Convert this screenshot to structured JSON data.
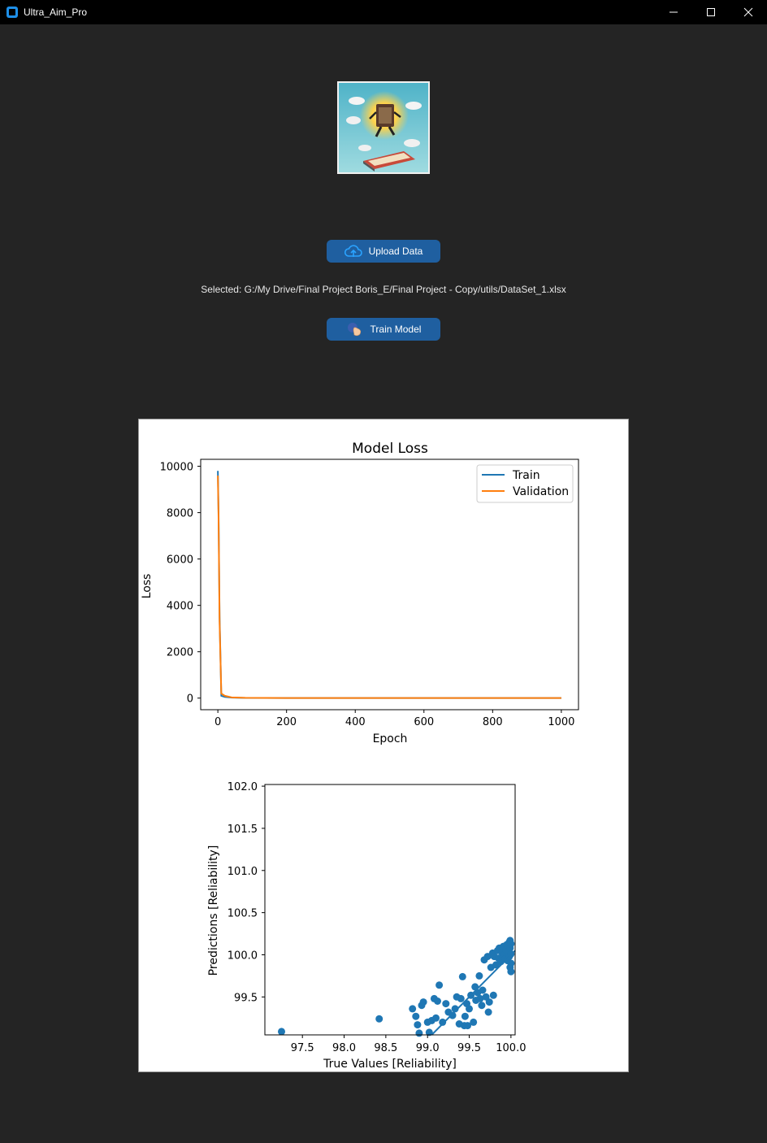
{
  "window": {
    "title": "Ultra_Aim_Pro"
  },
  "actions": {
    "upload_label": "Upload Data",
    "train_label": "Train Model",
    "selected_text": "Selected: G:/My Drive/Final Project Boris_E/Final Project - Copy/utils/DataSet_1.xlsx"
  },
  "colors": {
    "accent": "#1f5fa0",
    "train": "#1f77b4",
    "validation": "#ff7f0e"
  },
  "chart_data": [
    {
      "type": "line",
      "title": "Model Loss",
      "xlabel": "Epoch",
      "ylabel": "Loss",
      "xlim": [
        -50,
        1050
      ],
      "ylim": [
        -500,
        10300
      ],
      "xticks": [
        0,
        200,
        400,
        600,
        800,
        1000
      ],
      "yticks": [
        0,
        2000,
        4000,
        6000,
        8000,
        10000
      ],
      "legend": "top-right",
      "series": [
        {
          "name": "Train",
          "color": "#1f77b4",
          "x": [
            0,
            2,
            5,
            10,
            20,
            40,
            80,
            200,
            400,
            600,
            800,
            1000
          ],
          "y": [
            9800,
            8000,
            3500,
            100,
            50,
            20,
            10,
            5,
            4,
            3,
            3,
            3
          ]
        },
        {
          "name": "Validation",
          "color": "#ff7f0e",
          "x": [
            0,
            2,
            5,
            10,
            20,
            40,
            80,
            200,
            400,
            600,
            800,
            1000
          ],
          "y": [
            9600,
            7800,
            3300,
            200,
            100,
            30,
            12,
            6,
            5,
            4,
            4,
            4
          ]
        }
      ]
    },
    {
      "type": "scatter",
      "xlabel": "True Values [Reliability]",
      "ylabel": "Predictions [Reliability]",
      "xlim": [
        97.05,
        100.05
      ],
      "ylim": [
        99.05,
        102.02
      ],
      "xticks": [
        97.5,
        98.0,
        98.5,
        99.0,
        99.5,
        100.0
      ],
      "yticks": [
        99.5,
        100.0,
        100.5,
        101.0,
        101.5,
        102.0
      ],
      "color": "#1f77b4",
      "reference_line": [
        [
          99.05,
          99.05
        ],
        [
          100.05,
          100.05
        ]
      ],
      "points": [
        [
          97.25,
          99.09
        ],
        [
          98.42,
          99.24
        ],
        [
          98.82,
          99.36
        ],
        [
          98.86,
          99.27
        ],
        [
          98.88,
          99.17
        ],
        [
          98.9,
          99.07
        ],
        [
          98.93,
          99.4
        ],
        [
          98.95,
          99.44
        ],
        [
          99.0,
          99.2
        ],
        [
          99.02,
          99.08
        ],
        [
          99.05,
          99.22
        ],
        [
          99.08,
          99.48
        ],
        [
          99.1,
          99.25
        ],
        [
          99.12,
          99.45
        ],
        [
          99.14,
          99.64
        ],
        [
          99.18,
          99.2
        ],
        [
          99.22,
          99.42
        ],
        [
          99.25,
          99.32
        ],
        [
          99.3,
          99.28
        ],
        [
          99.33,
          99.36
        ],
        [
          99.35,
          99.5
        ],
        [
          99.38,
          99.18
        ],
        [
          99.4,
          99.48
        ],
        [
          99.42,
          99.74
        ],
        [
          99.44,
          99.16
        ],
        [
          99.45,
          99.27
        ],
        [
          99.47,
          99.42
        ],
        [
          99.48,
          99.16
        ],
        [
          99.5,
          99.36
        ],
        [
          99.52,
          99.52
        ],
        [
          99.55,
          99.2
        ],
        [
          99.57,
          99.62
        ],
        [
          99.58,
          99.46
        ],
        [
          99.6,
          99.55
        ],
        [
          99.62,
          99.75
        ],
        [
          99.63,
          99.48
        ],
        [
          99.65,
          99.4
        ],
        [
          99.66,
          99.58
        ],
        [
          99.68,
          99.94
        ],
        [
          99.7,
          99.5
        ],
        [
          99.72,
          99.98
        ],
        [
          99.73,
          99.32
        ],
        [
          99.74,
          99.44
        ],
        [
          99.76,
          99.85
        ],
        [
          99.78,
          100.02
        ],
        [
          99.79,
          99.52
        ],
        [
          99.8,
          99.98
        ],
        [
          99.82,
          99.88
        ],
        [
          99.84,
          100.05
        ],
        [
          99.85,
          99.96
        ],
        [
          99.86,
          100.08
        ],
        [
          99.88,
          99.92
        ],
        [
          99.89,
          100.03
        ],
        [
          99.9,
          99.96
        ],
        [
          99.91,
          100.1
        ],
        [
          99.92,
          100.0
        ],
        [
          99.93,
          99.95
        ],
        [
          99.94,
          100.06
        ],
        [
          99.95,
          100.12
        ],
        [
          99.96,
          99.93
        ],
        [
          99.97,
          100.04
        ],
        [
          99.98,
          100.15
        ],
        [
          99.98,
          99.98
        ],
        [
          99.99,
          100.08
        ],
        [
          99.99,
          99.85
        ],
        [
          100.0,
          100.13
        ],
        [
          100.0,
          99.9
        ],
        [
          100.0,
          100.01
        ],
        [
          100.0,
          99.8
        ],
        [
          99.99,
          100.17
        ]
      ]
    }
  ]
}
